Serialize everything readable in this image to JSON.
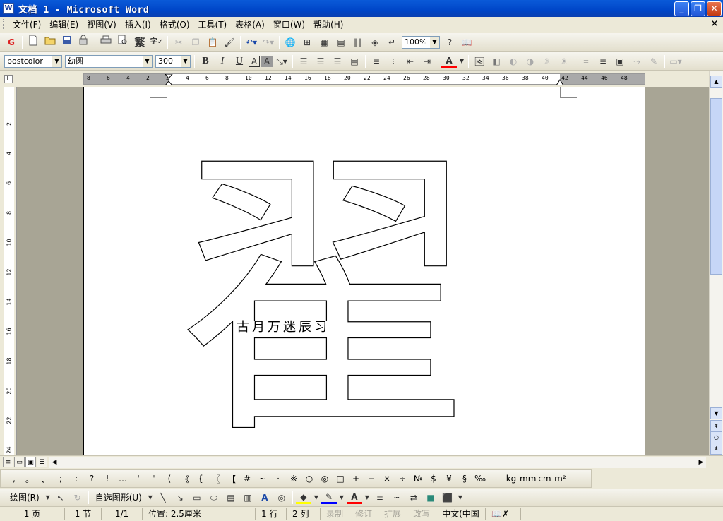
{
  "window": {
    "title": "文档 1 - Microsoft Word",
    "app_icon": "W",
    "minimize": "_",
    "restore": "❐",
    "close": "✕"
  },
  "menubar": {
    "items": [
      "文件(F)",
      "编辑(E)",
      "视图(V)",
      "插入(I)",
      "格式(O)",
      "工具(T)",
      "表格(A)",
      "窗口(W)",
      "帮助(H)"
    ],
    "doc_close": "✕"
  },
  "standard_toolbar": {
    "icons": [
      "wps-icon",
      "new-icon",
      "open-icon",
      "save-icon",
      "permission-icon",
      "print-icon",
      "print-preview-icon",
      "traditional-chinese-icon",
      "spelling-icon",
      "cut-icon",
      "copy-icon",
      "paste-icon",
      "format-painter-icon",
      "undo-icon",
      "redo-icon",
      "hyperlink-icon",
      "tables-borders-icon",
      "insert-table-icon",
      "insert-excel-icon",
      "columns-icon",
      "drawing-icon",
      "show-hide-icon"
    ],
    "zoom": "100%",
    "traditional_label": "繁"
  },
  "format_toolbar": {
    "style": "postcolor",
    "font": "幼圆",
    "size": "300",
    "bold": "B",
    "italic": "I",
    "underline": "U",
    "char_border": "A",
    "char_shading": "A",
    "font_color_label": "A"
  },
  "ruler": {
    "corner": "L",
    "ticks": [
      "8",
      "6",
      "4",
      "2",
      "2",
      "4",
      "6",
      "8",
      "10",
      "12",
      "14",
      "16",
      "18",
      "20",
      "22",
      "24",
      "26",
      "28",
      "30",
      "32",
      "34",
      "36",
      "38",
      "40",
      "42",
      "44",
      "46",
      "48"
    ],
    "vticks": [
      "2",
      "4",
      "6",
      "8",
      "10",
      "12",
      "14",
      "16",
      "18",
      "20",
      "22",
      "24"
    ]
  },
  "document": {
    "character": "翟",
    "font_face_label": "幼圆",
    "overlay_text": "古月万迷辰习"
  },
  "symbol_bar": {
    "symbols": [
      ",",
      "。",
      "、",
      ";",
      ":",
      "?",
      "!",
      "…",
      "'",
      "\"",
      "(",
      "《",
      "{",
      "〖",
      "【",
      "#",
      "~",
      "·",
      "※",
      "○",
      "◎",
      "□",
      "+",
      "−",
      "×",
      "÷",
      "№",
      "$",
      "¥",
      "§",
      "‰",
      "—",
      "kg",
      "mm",
      "cm",
      "m²"
    ]
  },
  "drawing_bar": {
    "draw_menu": "绘图(R)",
    "autoshapes_menu": "自选图形(U)"
  },
  "statusbar": {
    "page": "1 页",
    "section": "1 节",
    "page_of": "1/1",
    "position": "位置: 2.5厘米",
    "line": "1 行",
    "column": "2 列",
    "rec": "录制",
    "trk": "修订",
    "ext": "扩展",
    "ovr": "改写",
    "language": "中文(中国"
  },
  "colors": {
    "title_bar": "#0a5ad8",
    "font_color": "#ff0000",
    "highlight": "#ffff00",
    "line_color": "#0000ff"
  }
}
